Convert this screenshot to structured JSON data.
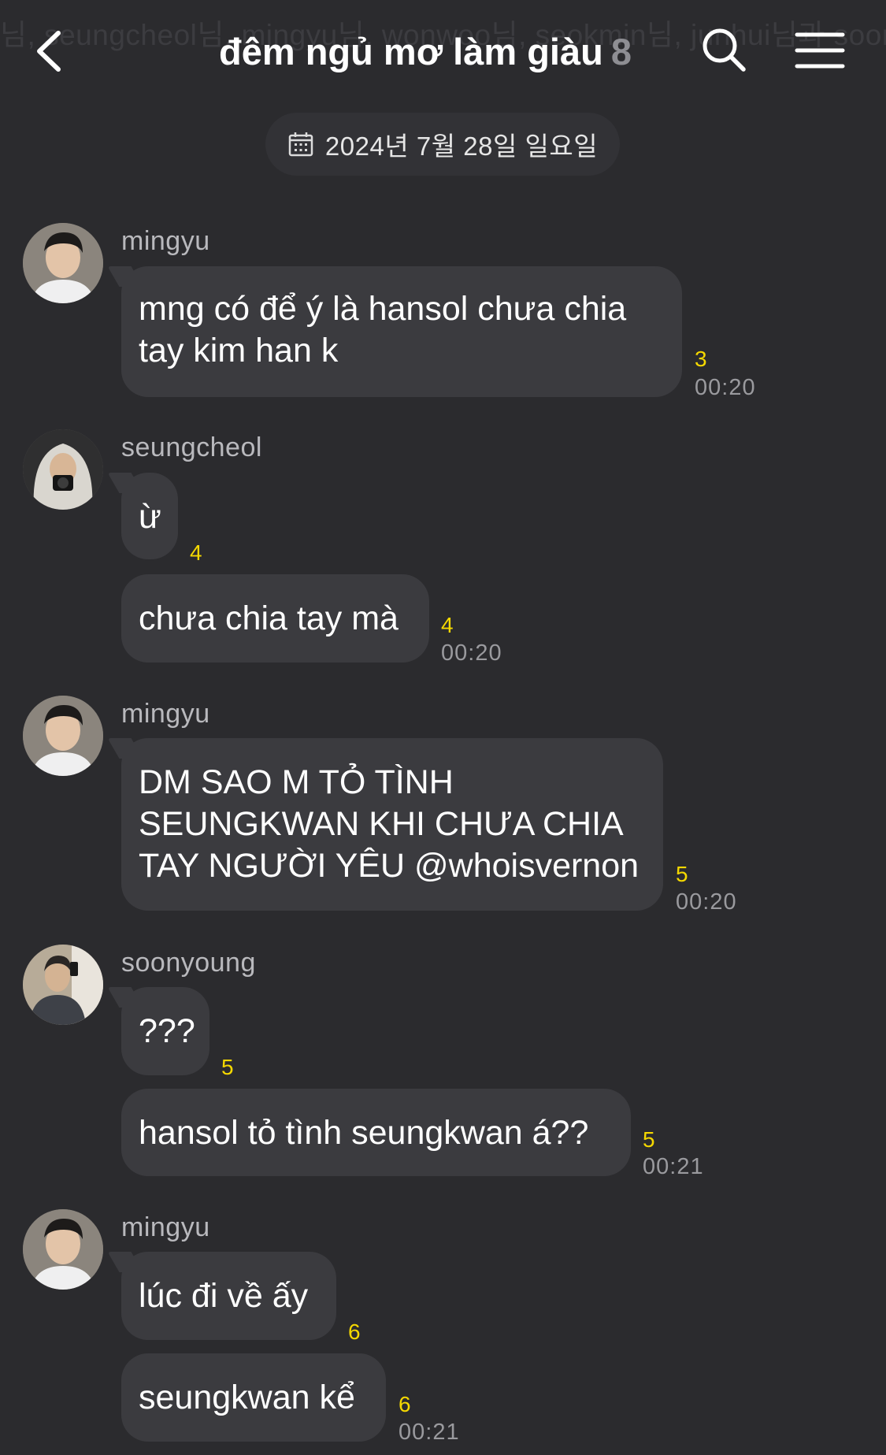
{
  "header": {
    "ghost_text": "님, seungcheol님, mingyu님, wonwoo님, seokmin님, junhui님과 soonyoung",
    "title": "đêm ngủ mơ làm giàu",
    "member_count": "8"
  },
  "date_pill": {
    "text": "2024년 7월 28일 일요일"
  },
  "messages": [
    {
      "sender": "mingyu",
      "bubbles": [
        {
          "text": "mng có để ý là hansol chưa chia\ntay kim han k",
          "unread": "3",
          "time": "00:20"
        }
      ]
    },
    {
      "sender": "seungcheol",
      "bubbles": [
        {
          "text": "ừ",
          "unread": "4",
          "time": ""
        },
        {
          "text": "chưa chia tay mà",
          "unread": "4",
          "time": "00:20"
        }
      ]
    },
    {
      "sender": "mingyu",
      "bubbles": [
        {
          "text": "DM SAO M TỎ TÌNH\nSEUNGKWAN KHI CHƯA CHIA\nTAY NGƯỜI YÊU @whoisvernon",
          "unread": "5",
          "time": "00:20"
        }
      ]
    },
    {
      "sender": "soonyoung",
      "bubbles": [
        {
          "text": "???",
          "unread": "5",
          "time": ""
        },
        {
          "text": "hansol tỏ tình seungkwan á??",
          "unread": "5",
          "time": "00:21"
        }
      ]
    },
    {
      "sender": "mingyu",
      "bubbles": [
        {
          "text": "lúc đi về ấy",
          "unread": "6",
          "time": ""
        },
        {
          "text": "seungkwan kể",
          "unread": "6",
          "time": "00:21"
        }
      ]
    }
  ]
}
